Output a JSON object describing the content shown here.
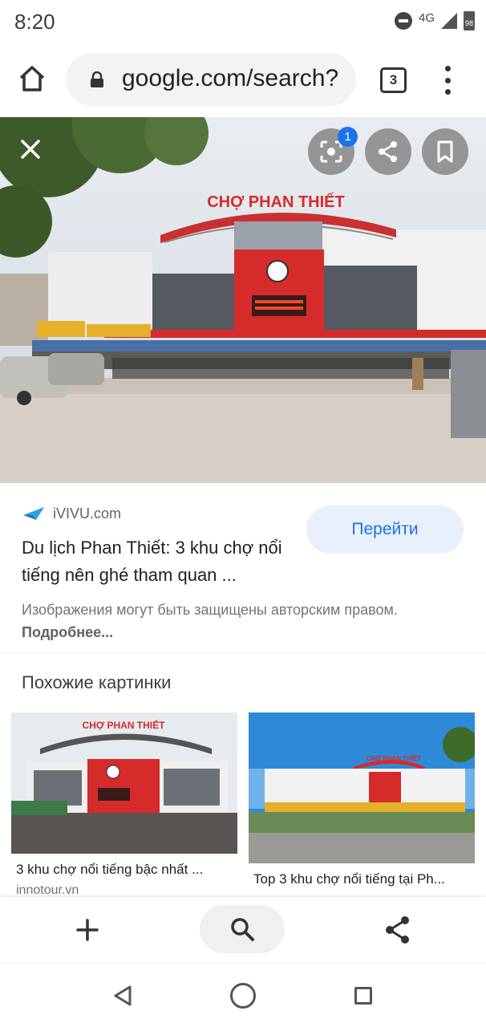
{
  "status_bar": {
    "time": "8:20",
    "network": "4G",
    "battery": "98"
  },
  "toolbar": {
    "url": "google.com/search?",
    "tab_count": "3"
  },
  "viewer": {
    "lens_badge": "1",
    "photo_sign": "CHỢ PHAN THIẾT"
  },
  "result": {
    "source": "iVIVU.com",
    "title": "Du lịch Phan Thiết: 3 khu chợ nổi tiếng nên ghé tham quan ...",
    "visit_label": "Перейти",
    "copyright_text": "Изображения могут быть защищены авторским правом.",
    "copyright_link": "Подробнее..."
  },
  "similar": {
    "heading": "Похожие картинки",
    "items": [
      {
        "caption": "3 khu chợ nổi tiếng bậc nhất ...",
        "source": "innotour.vn",
        "sign": "CHỢ PHAN THIẾT"
      },
      {
        "caption": "Top 3 khu chợ nổi tiếng tại Ph...",
        "sign": "CHỢ PHAN THIẾT"
      }
    ]
  },
  "colors": {
    "accent": "#1a73e8",
    "visit_bg": "#e8f0fe",
    "market_red": "#d62b2b"
  },
  "icons": [
    "home-icon",
    "lock-icon",
    "tabs-icon",
    "more-vert-icon",
    "close-icon",
    "lens-icon",
    "share-icon",
    "bookmark-icon",
    "add-icon",
    "search-icon",
    "back-icon",
    "home-circle-icon",
    "recents-icon"
  ]
}
